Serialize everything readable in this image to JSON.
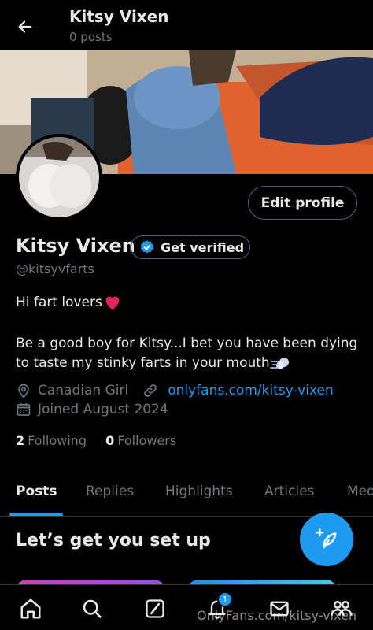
{
  "header": {
    "title": "Kitsy Vixen",
    "subtitle": "0 posts"
  },
  "profile": {
    "name": "Kitsy Vixen",
    "handle": "@kitsyvfarts",
    "edit_label": "Edit profile",
    "verify_label": "Get verified",
    "bio_line1": "Hi fart lovers",
    "bio_line2": "Be a good boy for Kitsy...I bet you have been dying",
    "bio_line3": "to taste my stinky farts in your mouth",
    "location": "Canadian Girl",
    "website": "onlyfans.com/kitsy-vixen",
    "joined": "Joined August 2024",
    "following_count": "2",
    "following_label": "Following",
    "followers_count": "0",
    "followers_label": "Followers"
  },
  "tabs": [
    {
      "label": "Posts"
    },
    {
      "label": "Replies"
    },
    {
      "label": "Highlights"
    },
    {
      "label": "Articles"
    },
    {
      "label": "Media"
    }
  ],
  "setup_title": "Let’s get you set up",
  "nav": {
    "notifications_badge": "1"
  },
  "watermark": "OnlyFans.com/kitsy-vixen",
  "colors": {
    "accent": "#1d9bf0",
    "background": "#000000",
    "muted": "#71767b"
  }
}
